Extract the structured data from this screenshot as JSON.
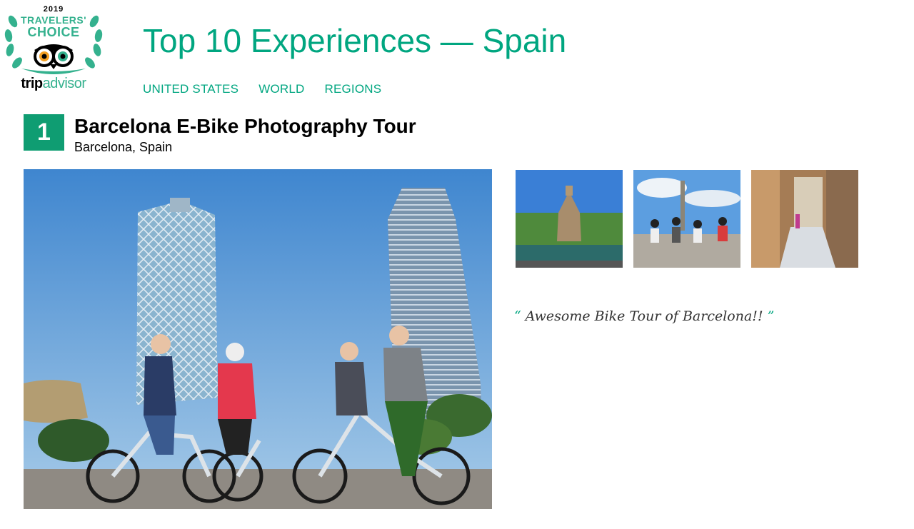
{
  "logo": {
    "year": "2019",
    "line1": "TRAVELERS'",
    "line2": "CHOICE",
    "brand_part1": "trip",
    "brand_part2": "advisor",
    "colors": {
      "green": "#34b18e",
      "owl_orange": "#f4a023",
      "black": "#000000"
    }
  },
  "header": {
    "title": "Top 10 Experiences — Spain",
    "nav": [
      "UNITED STATES",
      "WORLD",
      "REGIONS"
    ],
    "accent": "#00a680"
  },
  "experience": {
    "rank": "1",
    "rank_color": "#0f9d72",
    "title": "Barcelona E-Bike Photography Tour",
    "location": "Barcelona, Spain",
    "main_photo": "group-of-four-cyclists-with-e-bikes-in-front-of-twin-towers-barcelona",
    "thumbnails": [
      "park-fountain-cascade",
      "cyclists-near-columbus-monument",
      "narrow-old-town-alley"
    ],
    "quote_open": "“",
    "quote_text": "Awesome Bike Tour of Barcelona!!",
    "quote_close": "”"
  }
}
